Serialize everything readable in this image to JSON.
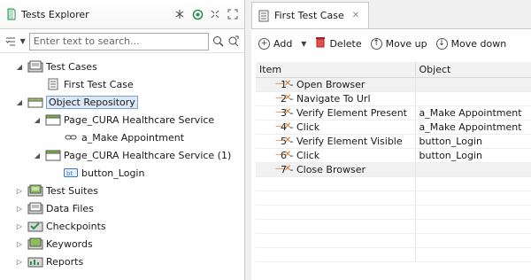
{
  "explorer": {
    "title": "Tests Explorer",
    "search_placeholder": "Enter text to search...",
    "tree": [
      {
        "label": "Test Cases",
        "level": 0,
        "expanded": true,
        "icon": "folder-testcases-icon"
      },
      {
        "label": "First Test Case",
        "level": 1,
        "icon": "testcase-icon"
      },
      {
        "label": "Object Repository",
        "level": 0,
        "expanded": true,
        "selected": true,
        "icon": "folder-objects-icon"
      },
      {
        "label": "Page_CURA Healthcare Service",
        "level": 1,
        "expanded": true,
        "icon": "folder-page-icon"
      },
      {
        "label": "a_Make Appointment",
        "level": 2,
        "icon": "link-icon"
      },
      {
        "label": "Page_CURA Healthcare Service (1)",
        "level": 1,
        "expanded": true,
        "icon": "folder-page-icon"
      },
      {
        "label": "button_Login",
        "level": 2,
        "icon": "button-bt-icon"
      },
      {
        "label": "Test Suites",
        "level": 0,
        "expanded": false,
        "icon": "folder-suites-icon"
      },
      {
        "label": "Data Files",
        "level": 0,
        "expanded": false,
        "icon": "folder-data-icon"
      },
      {
        "label": "Checkpoints",
        "level": 0,
        "expanded": false,
        "icon": "folder-checkpoints-icon"
      },
      {
        "label": "Keywords",
        "level": 0,
        "expanded": false,
        "icon": "folder-keywords-icon"
      },
      {
        "label": "Reports",
        "level": 0,
        "expanded": false,
        "icon": "folder-reports-icon"
      }
    ]
  },
  "editor": {
    "tab_title": "First Test Case",
    "toolbar": {
      "add": "Add",
      "delete": "Delete",
      "move_up": "Move up",
      "move_down": "Move down"
    },
    "columns": {
      "item": "Item",
      "object": "Object"
    },
    "steps": [
      {
        "item": "1 - Open Browser",
        "object": ""
      },
      {
        "item": "2 - Navigate To Url",
        "object": ""
      },
      {
        "item": "3 - Verify Element Present",
        "object": "a_Make Appointment"
      },
      {
        "item": "4 - Click",
        "object": "a_Make Appointment"
      },
      {
        "item": "5 - Verify Element Visible",
        "object": "button_Login"
      },
      {
        "item": "6 - Click",
        "object": "button_Login"
      },
      {
        "item": "7 - Close Browser",
        "object": ""
      }
    ]
  },
  "colors": {
    "selection_bg": "#dce8f6",
    "selection_border": "#7da2ce",
    "folder_green": "#7cb342",
    "step_arrow": "#c8783a"
  }
}
